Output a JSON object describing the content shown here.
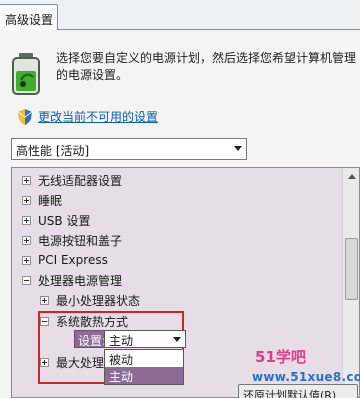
{
  "tabs": [
    {
      "label": "高级设置",
      "active": true
    }
  ],
  "description": "选择您要自定义的电源计划，然后选择您希望计算机管理的电源设置。",
  "uac_link": "更改当前不可用的设置",
  "plan_select": {
    "value": "高性能 [活动]"
  },
  "tree_items": [
    {
      "label": "无线适配器设置",
      "expander": "plus",
      "level": 0
    },
    {
      "label": "睡眠",
      "expander": "plus",
      "level": 0
    },
    {
      "label": "USB 设置",
      "expander": "plus",
      "level": 0
    },
    {
      "label": "电源按钮和盖子",
      "expander": "plus",
      "level": 0
    },
    {
      "label": "PCI Express",
      "expander": "plus",
      "level": 0
    },
    {
      "label": "处理器电源管理",
      "expander": "minus",
      "level": 0
    },
    {
      "label": "最小处理器状态",
      "expander": "plus",
      "level": 1
    },
    {
      "label": "系统散热方式",
      "expander": "minus",
      "level": 1
    },
    {
      "label": "最大处理",
      "expander": "plus",
      "level": 1
    }
  ],
  "cooling_setting": {
    "label": "设置:",
    "value": "主动",
    "options": [
      {
        "label": "被动",
        "selected": false
      },
      {
        "label": "主动",
        "selected": true
      }
    ]
  },
  "bottom_button": "还原计划默认值(R)",
  "watermark": {
    "name": "51学吧",
    "url": "www.51xue8.com"
  },
  "colors": {
    "selection": "#8c6c94",
    "tree_background": "#e6dde6",
    "link": "#0a5fb4",
    "highlight": "#d2232a"
  }
}
